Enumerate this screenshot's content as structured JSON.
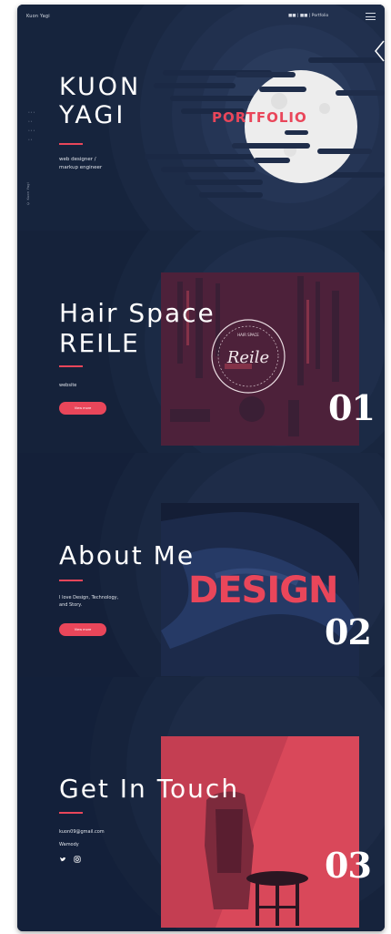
{
  "header": {
    "site_name": "Kuon Yagi",
    "nav_text": "■■ | ■■ | Portfolio"
  },
  "sidebar": {
    "links": [
      "• • •",
      "• •",
      "• • •",
      "• •"
    ],
    "vertical_text": "© Kuon Yagi"
  },
  "hero": {
    "title_line1": "KUON",
    "title_line2": "YAGI",
    "subtitle_line1": "web designer /",
    "subtitle_line2": "markup engineer",
    "portfolio_word": "PORTFOLIO"
  },
  "sections": [
    {
      "title_line1": "Hair Space",
      "title_line2": "REILE",
      "subtitle": "website",
      "button_label": "View more",
      "number": "01",
      "logo_text": "Reile",
      "logo_ring_text": "HAIR SPACE"
    },
    {
      "title": "About Me",
      "desc_line1": "I love Design, Technology,",
      "desc_line2": "and Story.",
      "button_label": "View more",
      "number": "02",
      "image_word": "DESIGN"
    },
    {
      "title": "Get In Touch",
      "email": "kuon09@gmail.com",
      "handle": "Wamody",
      "number": "03",
      "social_icons": [
        "twitter-icon",
        "instagram-icon"
      ]
    }
  ],
  "colors": {
    "background": "#15223a",
    "accent": "#e9465a",
    "text": "#ffffff"
  }
}
